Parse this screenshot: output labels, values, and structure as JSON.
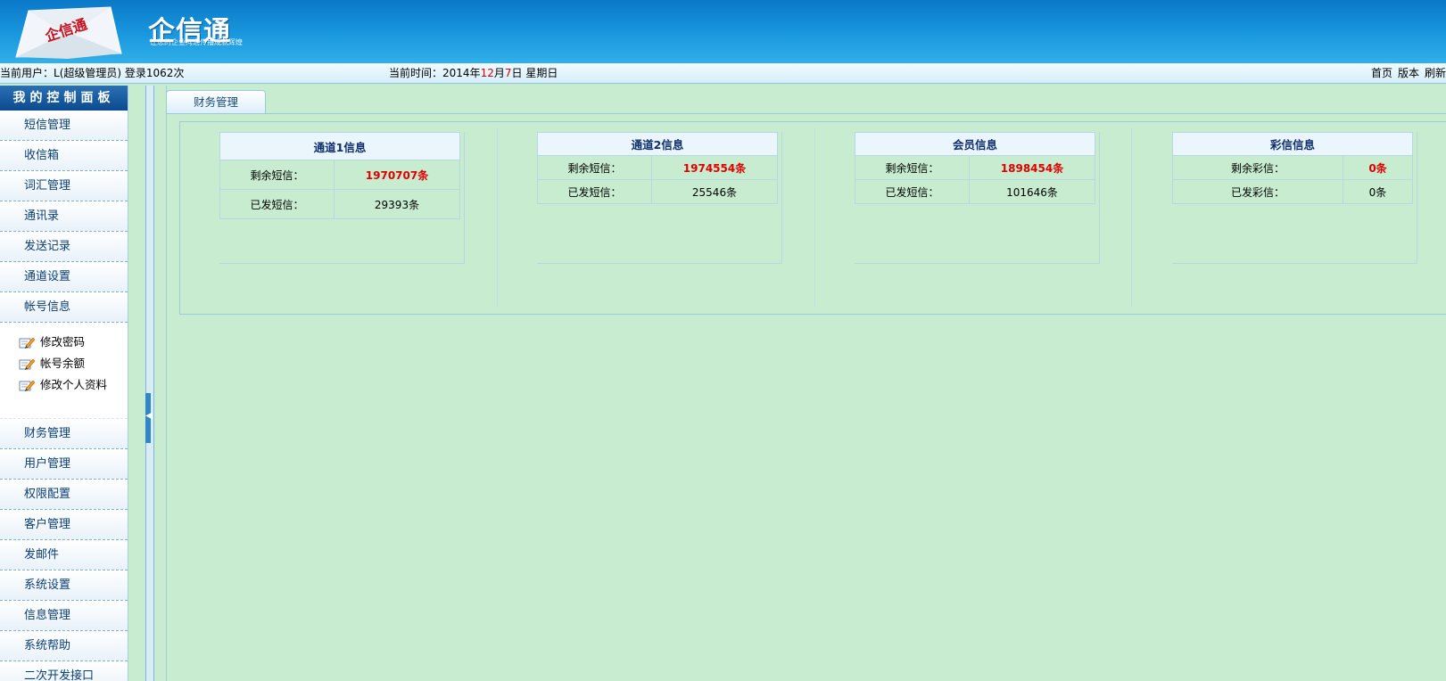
{
  "header": {
    "brand_title": "企信通",
    "brand_slogan": "让您的企业沟通传播成就辉煌",
    "logo_text": "企信通"
  },
  "statusbar": {
    "user_prefix": "当前用户：",
    "user_name": "L(超级管理员)",
    "login_text": "登录1062次",
    "time_prefix": "当前时间：",
    "time_year": "2014年",
    "time_month_num": "12",
    "time_month_unit": "月",
    "time_day_num": "7",
    "time_day_unit": "日",
    "time_weekday": "星期日",
    "links": [
      "首页",
      "版本",
      "刷新"
    ]
  },
  "sidebar": {
    "title": "我的控制面板",
    "items_top": [
      "短信管理",
      "收信箱",
      "词汇管理",
      "通讯录",
      "发送记录",
      "通道设置",
      "帐号信息"
    ],
    "sub_items": [
      "修改密码",
      "帐号余额",
      "修改个人资料"
    ],
    "items_bottom": [
      "财务管理",
      "用户管理",
      "权限配置",
      "客户管理",
      "发邮件",
      "系统设置",
      "信息管理",
      "系统帮助",
      "二次开发接口"
    ]
  },
  "tab": {
    "label": "财务管理"
  },
  "cards": [
    {
      "title": "通道1信息",
      "row1_label": "剩余短信：",
      "row1_value": "1970707条",
      "row2_label": "已发短信：",
      "row2_value": "29393条"
    },
    {
      "title": "通道2信息",
      "row1_label": "剩余短信：",
      "row1_value": "1974554条",
      "row2_label": "已发短信：",
      "row2_value": "25546条"
    },
    {
      "title": "会员信息",
      "row1_label": "剩余短信：",
      "row1_value": "1898454条",
      "row2_label": "已发短信：",
      "row2_value": "101646条"
    },
    {
      "title": "彩信信息",
      "row1_label": "剩余彩信：",
      "row1_value": "0条",
      "row2_label": "已发彩信：",
      "row2_value": "0条"
    }
  ],
  "colors": {
    "header_blue": "#1a98de",
    "content_bg": "#c8ecd0",
    "highlight_red": "#e00000"
  }
}
